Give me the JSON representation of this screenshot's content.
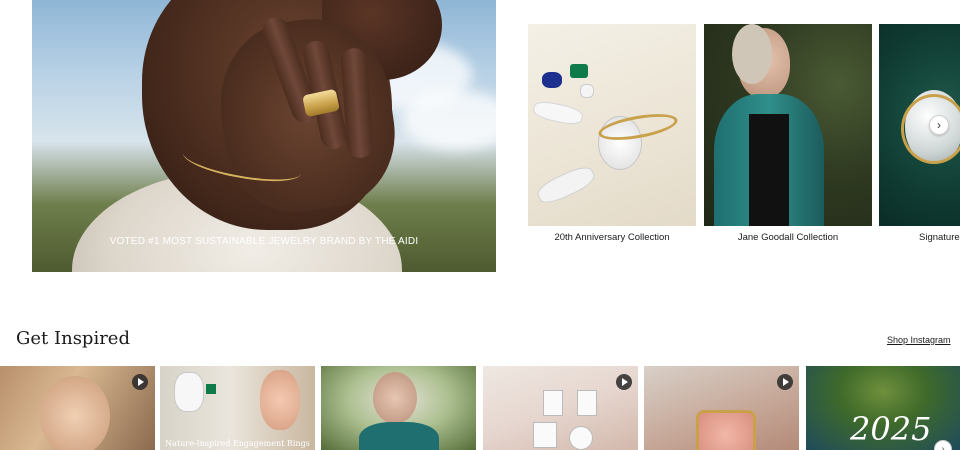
{
  "hero": {
    "caption": "VOTED #1 MOST SUSTAINABLE JEWELRY BRAND BY THE AIDI"
  },
  "collections": {
    "items": [
      {
        "label": "20th Anniversary Collection"
      },
      {
        "label": "Jane Goodall Collection"
      },
      {
        "label": "Signature"
      }
    ],
    "next_icon": "chevron-right-icon"
  },
  "inspired": {
    "title": "Get Inspired",
    "shop_link": "Shop Instagram",
    "tiles": [
      {
        "type": "video",
        "caption": ""
      },
      {
        "type": "image",
        "caption": "Nature-Inspired Engagement Rings"
      },
      {
        "type": "image",
        "caption": ""
      },
      {
        "type": "video",
        "caption": ""
      },
      {
        "type": "video",
        "caption": ""
      },
      {
        "type": "image",
        "caption": "2025"
      }
    ]
  },
  "colors": {
    "accent_gold": "#c9a14a",
    "text": "#1a1a1a",
    "background": "#ffffff"
  }
}
